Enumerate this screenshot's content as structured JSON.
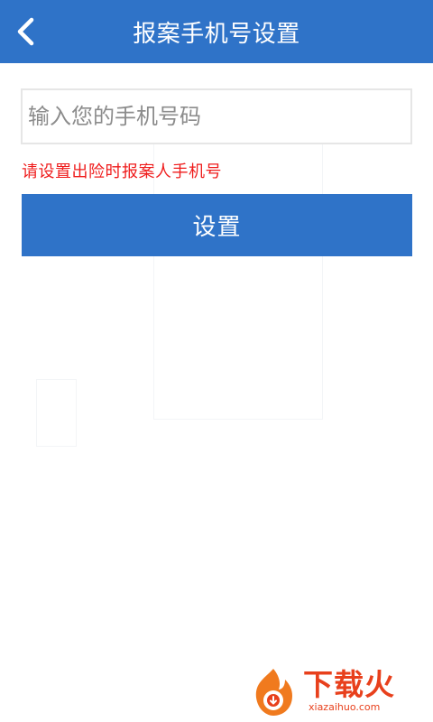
{
  "header": {
    "title": "报案手机号设置",
    "back_icon": "chevron-left-icon",
    "background_color": "#2f73c8"
  },
  "form": {
    "phone_placeholder": "输入您的手机号码",
    "phone_value": "",
    "hint": "请设置出险时报案人手机号",
    "hint_color": "#ef1c1c",
    "submit_label": "设置"
  },
  "watermark": {
    "title": "下载火",
    "url": "xiazaihuo.com",
    "logo_icon": "flame-logo-icon",
    "color": "#e8401c"
  }
}
